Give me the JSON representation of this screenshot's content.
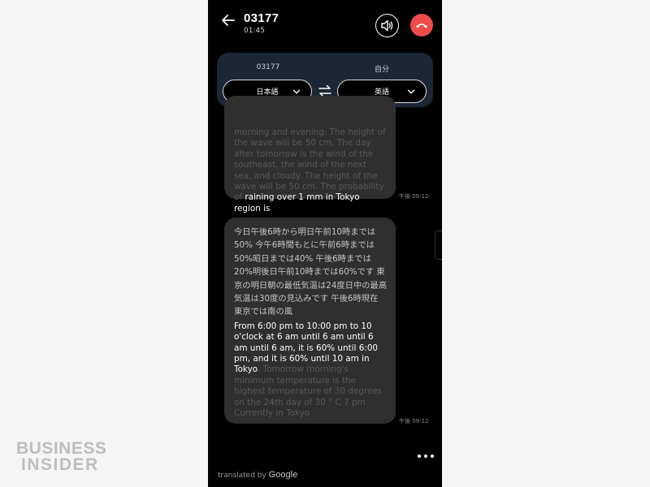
{
  "watermark": {
    "line1": "BUSINESS",
    "line2": "INSIDER"
  },
  "call": {
    "caller_id": "03177",
    "duration": "01:45",
    "colors": {
      "end_call": "#ee4b4b",
      "panel": "#1c2736",
      "bubble": "#2f2f2f"
    }
  },
  "languages": {
    "left_label": "03177",
    "right_label": "自分",
    "left_value": "日本語",
    "right_value": "英語"
  },
  "messages": [
    {
      "text_faded": "morning and evening. The height of the wave will be 50 cm. The day after tomorrow is the wind of the southeast, the wind of the next sea, and cloudy. The height of the wave will be 50 cm. The probability of",
      "text_bright": "raining over 1 mm in Tokyo region is",
      "time": "午後 09:12"
    },
    {
      "original": "今日午後6時から明日午前10時までは50% 今午6時間もとに午前6時までは50%昭日までは40% 午後6時までは20%明後日午前10時までは60%です 東京の明日朝の最低気温は24度日中の最高気温は30度の見込みです 午後6時現在 東京では南の風",
      "translated_bright": "From 6:00 pm to 10:00 pm to 10 o'clock at 6 am until 6 am until 6 am until 6 am, it is 60% until 6:00 pm, and it is 60% until 10 am in Tokyo",
      "translated_faded": ". Tomorrow morning's minimum temperature is the highest temperature of 30 degrees on the 24th day of 30 ° C 7 pm Currently in Tokyo",
      "time": "午後 09:12"
    }
  ],
  "footer": {
    "prefix": "translated by",
    "brand": "Google"
  },
  "icons": {
    "back": "arrow-left-icon",
    "speaker": "speaker-icon",
    "end_call": "phone-hangup-icon",
    "swap": "swap-arrows-icon",
    "more": "more-dots-icon"
  }
}
